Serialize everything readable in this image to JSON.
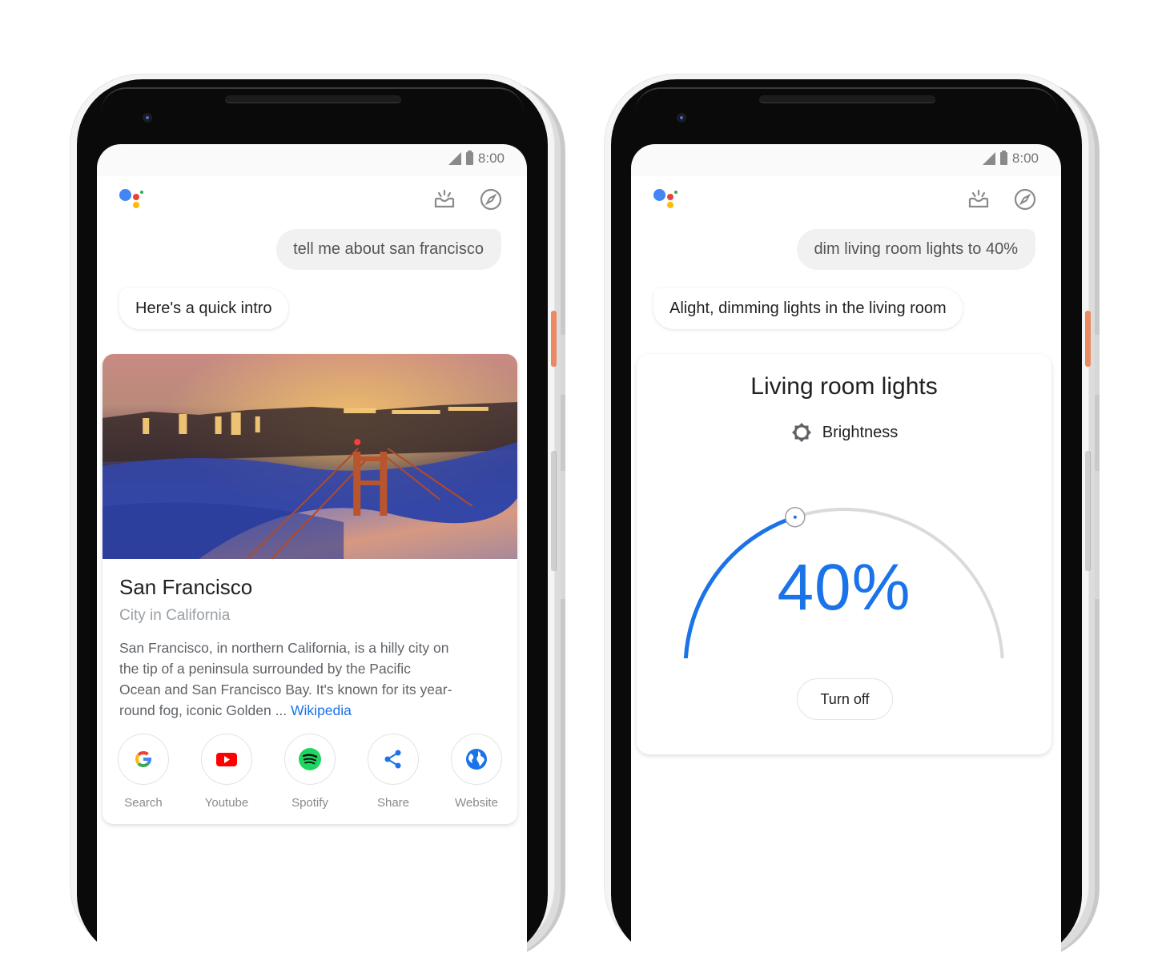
{
  "status_bar": {
    "time": "8:00"
  },
  "phones": [
    {
      "conversation": {
        "user_query": "tell me about san francisco",
        "assistant_reply": "Here's a quick intro"
      },
      "knowledge_card": {
        "title": "San Francisco",
        "subtitle": "City in California",
        "description": "San Francisco, in northern California, is a hilly city on the tip of a peninsula surrounded by the Pacific Ocean and San Francisco Bay. It's known for its year-round fog, iconic Golden ... ",
        "source_link": "Wikipedia",
        "image_alt": "Golden Gate Bridge above fog with city lights",
        "actions": [
          {
            "label": "Search",
            "icon": "google-icon"
          },
          {
            "label": "Youtube",
            "icon": "youtube-icon"
          },
          {
            "label": "Spotify",
            "icon": "spotify-icon"
          },
          {
            "label": "Share",
            "icon": "share-icon"
          },
          {
            "label": "Website",
            "icon": "globe-icon"
          }
        ]
      }
    },
    {
      "conversation": {
        "user_query": "dim living room lights to 40%",
        "assistant_reply": "Alight, dimming lights in the living room"
      },
      "lights_card": {
        "title": "Living room lights",
        "control_label": "Brightness",
        "value_text": "40%",
        "brightness_fraction": 0.4,
        "turn_off_label": "Turn off"
      }
    }
  ],
  "colors": {
    "accent_blue": "#1a73e8",
    "track_gray": "#dadada",
    "google_blue": "#4285f4",
    "google_red": "#ea4335",
    "google_yellow": "#fbbc05",
    "google_green": "#34a853",
    "youtube_red": "#ff0000",
    "spotify_green": "#1ed760",
    "power_button": "#e98a63"
  }
}
